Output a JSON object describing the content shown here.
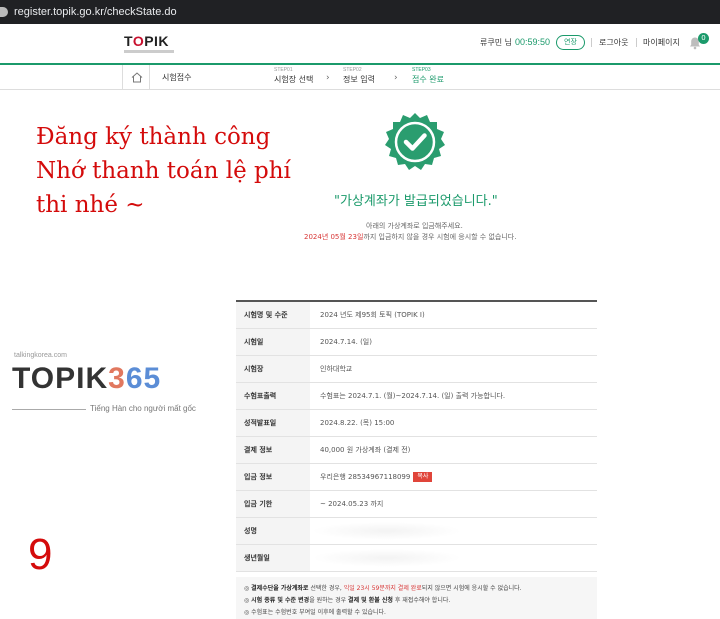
{
  "browser": {
    "url": "register.topik.go.kr/checkState.do"
  },
  "header": {
    "logo_text_1": "T",
    "logo_text_o": "O",
    "logo_text_2": "PIK",
    "user": "류쿠민 님",
    "timer": "00:59:50",
    "extend_label": "연장",
    "logout_label": "로그아웃",
    "mypage_label": "마이페이지",
    "notification_count": "0"
  },
  "stepbar": {
    "menu_label": "시험접수",
    "steps": [
      {
        "num": "STEP01",
        "label": "시험장 선택"
      },
      {
        "num": "STEP02",
        "label": "정보 입력"
      },
      {
        "num": "STEP03",
        "label": "접수 완료"
      }
    ],
    "active_color": "#1b9a6b"
  },
  "overlay": {
    "note_line1": "Đăng ký thành công",
    "note_line2": "Nhớ thanh toán lệ phí",
    "note_line3": "thi nhé ~",
    "page_number": "9",
    "watermark_site": "talkingkorea.com",
    "watermark_logo_1": "TOPIK",
    "watermark_logo_2": "3",
    "watermark_logo_3": "65",
    "watermark_tagline": "Tiếng Hàn cho người mất gốc"
  },
  "result": {
    "icon": "check-badge-icon",
    "title": "\"가상계좌가 발급되었습니다.\"",
    "notice1": "아래의 가상계좌로 입금해주세요.",
    "notice2_red": "2024년 05월 23일",
    "notice2_rest": "까지 입금하지 않을 경우 시험에 응시할 수 없습니다."
  },
  "info": {
    "rows": [
      {
        "label": "시험명 및 수준",
        "value": "2024 년도 제95회 토픽 (TOPIK Ⅰ)"
      },
      {
        "label": "시험일",
        "value": "2024.7.14. (일)"
      },
      {
        "label": "시험장",
        "value": "인하대학교"
      },
      {
        "label": "수험표출력",
        "value": "수험표는 2024.7.1. (월)~2024.7.14. (일) 출력 가능합니다."
      },
      {
        "label": "성적발표일",
        "value": "2024.8.22. (목) 15:00"
      },
      {
        "label": "결제 정보",
        "value": "40,000 원 가상계좌 (결제 전)"
      },
      {
        "label": "입금 정보",
        "value": "우리은행 28534967118099",
        "tag": "복사"
      },
      {
        "label": "입금 기한",
        "value": "~ 2024.05.23 까지"
      },
      {
        "label": "성명",
        "value": ""
      },
      {
        "label": "생년월일",
        "value": ""
      }
    ]
  },
  "notes": {
    "n1_pre": "◎ ",
    "n1_bold": "결제수단을 가상계좌로",
    "n1_mid": " 선택한 경우, ",
    "n1_red": "익일 23시 59분까지 결제 완료",
    "n1_post": "되지 않으면 시험에 응시할 수 없습니다.",
    "n2_pre": "◎ ",
    "n2_bold1": "시험 종류 및 수준 변경",
    "n2_mid": "을 원하는 경우 ",
    "n2_bold2": "결제 및 환불 신청",
    "n2_post": " 후 재접수해야 합니다.",
    "n3": "◎ 수험표는 수험번호 부여일 이후에 출력할 수 있습니다."
  }
}
